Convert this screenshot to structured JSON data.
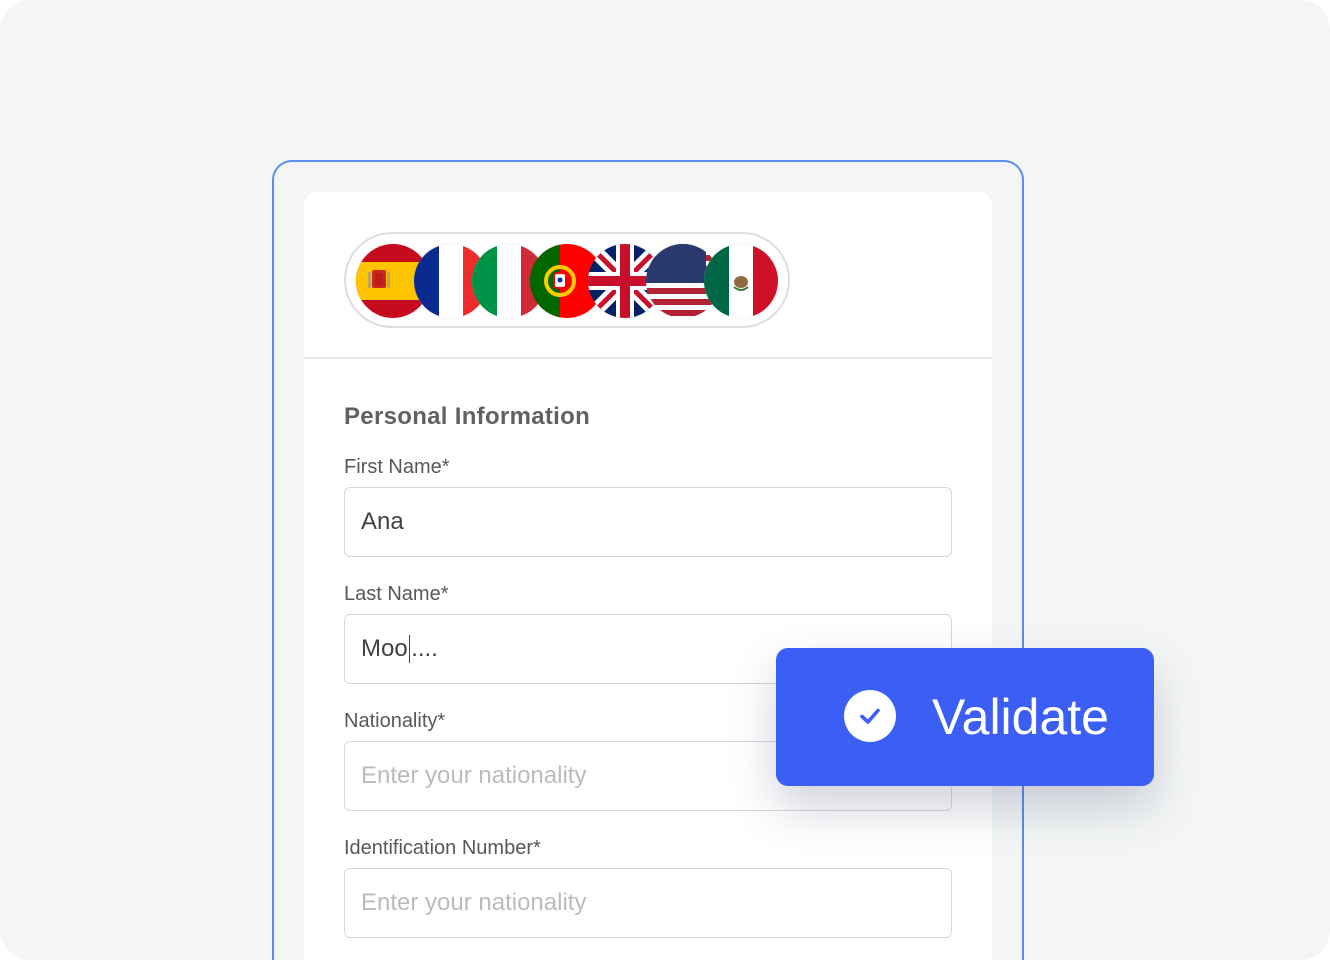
{
  "flags": [
    {
      "icon": "spain-flag-icon"
    },
    {
      "icon": "france-flag-icon"
    },
    {
      "icon": "italy-flag-icon"
    },
    {
      "icon": "portugal-flag-icon"
    },
    {
      "icon": "united-kingdom-flag-icon"
    },
    {
      "icon": "united-states-flag-icon"
    },
    {
      "icon": "mexico-flag-icon"
    }
  ],
  "form": {
    "section_title": "Personal Information",
    "first_name": {
      "label": "First Name*",
      "value": "Ana"
    },
    "last_name": {
      "label": "Last Name*",
      "value_before_caret": "Moo",
      "value_after_caret": "...."
    },
    "nationality": {
      "label": "Nationality*",
      "placeholder": "Enter your nationality"
    },
    "identification": {
      "label": "Identification Number*",
      "placeholder": "Enter your nationality"
    }
  },
  "validate_button": {
    "label": "Validate",
    "icon": "check-circle-icon"
  },
  "colors": {
    "accent": "#3b5ef5",
    "frame": "#5b8ef0",
    "background": "#f4f6f6"
  }
}
